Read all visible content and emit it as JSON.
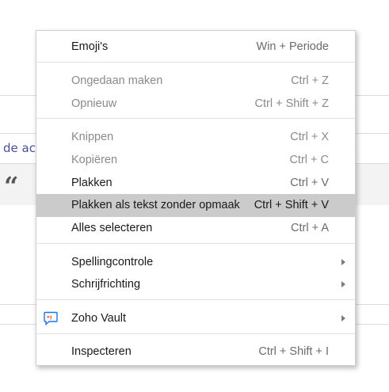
{
  "background": {
    "link_text": "de ac",
    "quote_glyph": "“"
  },
  "context_menu": {
    "emoji": {
      "label": "Emoji's",
      "shortcut": "Win + Periode"
    },
    "undo": {
      "label": "Ongedaan maken",
      "shortcut": "Ctrl + Z"
    },
    "redo": {
      "label": "Opnieuw",
      "shortcut": "Ctrl + Shift + Z"
    },
    "cut": {
      "label": "Knippen",
      "shortcut": "Ctrl + X"
    },
    "copy": {
      "label": "Kopiëren",
      "shortcut": "Ctrl + C"
    },
    "paste": {
      "label": "Plakken",
      "shortcut": "Ctrl + V"
    },
    "paste_plain": {
      "label": "Plakken als tekst zonder opmaak",
      "shortcut": "Ctrl + Shift + V"
    },
    "select_all": {
      "label": "Alles selecteren",
      "shortcut": "Ctrl + A"
    },
    "spellcheck": {
      "label": "Spellingcontrole"
    },
    "writing_direction": {
      "label": "Schrijfrichting"
    },
    "zoho_vault": {
      "label": "Zoho Vault",
      "icon": "zoho-vault-icon"
    },
    "inspect": {
      "label": "Inspecteren",
      "shortcut": "Ctrl + Shift + I"
    }
  },
  "colors": {
    "highlight": "#cbcbcb",
    "disabled_text": "#8a8a8a",
    "link": "#4a4f98",
    "vault_icon": "#1a73e8",
    "vault_icon_accent": "#e53935"
  }
}
